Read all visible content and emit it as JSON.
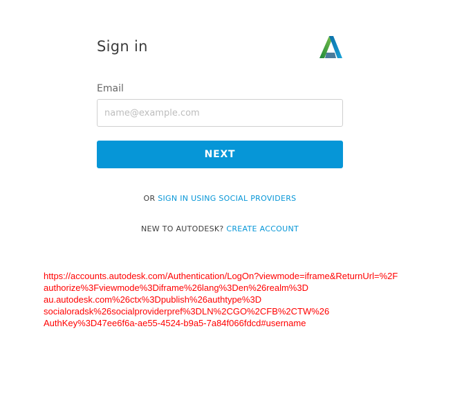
{
  "header": {
    "title": "Sign in",
    "logo_icon": "autodesk-logo-icon"
  },
  "form": {
    "email_label": "Email",
    "email_placeholder": "name@example.com",
    "email_value": "",
    "next_label": "NEXT"
  },
  "social": {
    "prefix": "OR ",
    "link_label": "SIGN IN USING SOCIAL PROVIDERS"
  },
  "create": {
    "prefix": "NEW TO AUTODESK? ",
    "link_label": "CREATE ACCOUNT"
  },
  "url_text": {
    "lines": [
      "https://accounts.autodesk.com/Authentication/LogOn?viewmode=iframe&ReturnUrl=%2F",
      "authorize%3Fviewmode%3Diframe%26lang%3Den%26realm%3D",
      "au.autodesk.com%26ctx%3Dpublish%26authtype%3D",
      "socialoradsk%26socialproviderpref%3DLN%2CGO%2CFB%2CTW%26",
      "AuthKey%3D47ee6f6a-ae55-4524-b9a5-7a84f066fdcd#username"
    ]
  },
  "colors": {
    "accent": "#0696d7",
    "url_text": "#ff0000",
    "title": "#3c3c3c"
  }
}
